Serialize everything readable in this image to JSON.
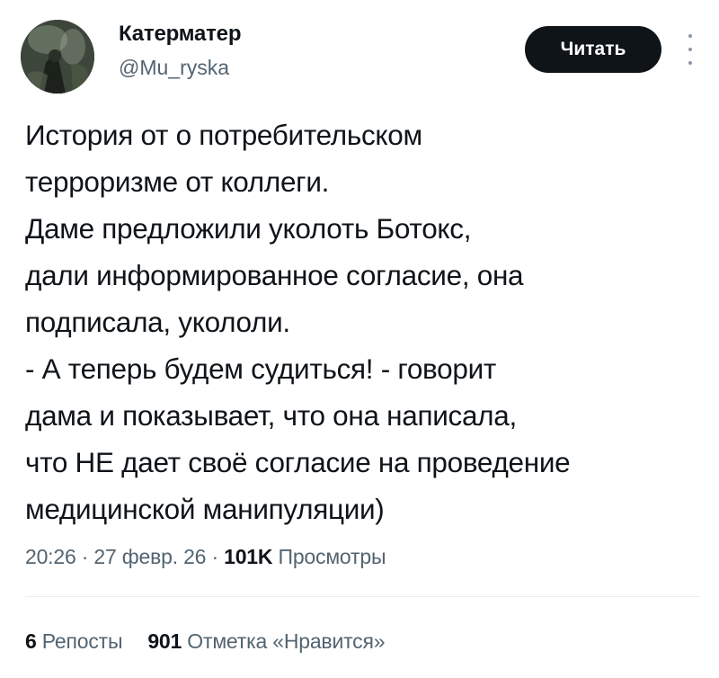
{
  "author": {
    "name": "Катерматер",
    "handle": "@Mu_ryska"
  },
  "follow_button": {
    "label": "Читать"
  },
  "more_icon": "more-vertical-icon",
  "tweet": {
    "lines": [
      "История от о потребительском",
      "терроризме от коллеги.",
      "Даме предложили уколоть Ботокс,",
      "дали информированное согласие, она",
      "подписала, укололи.",
      "- А теперь будем судиться! - говорит",
      "дама и показывает, что она написала,",
      "что НЕ дает своё согласие на проведение",
      "медицинской манипуляции)"
    ]
  },
  "meta": {
    "time": "20:26",
    "sep1": " · ",
    "date": "27 февр. 26",
    "sep2": " · ",
    "views_count": "101K",
    "views_label": " Просмотры"
  },
  "stats": {
    "reposts_count": "6",
    "reposts_label": " Репосты",
    "likes_count": "901",
    "likes_label": " Отметка «Нравится»"
  }
}
